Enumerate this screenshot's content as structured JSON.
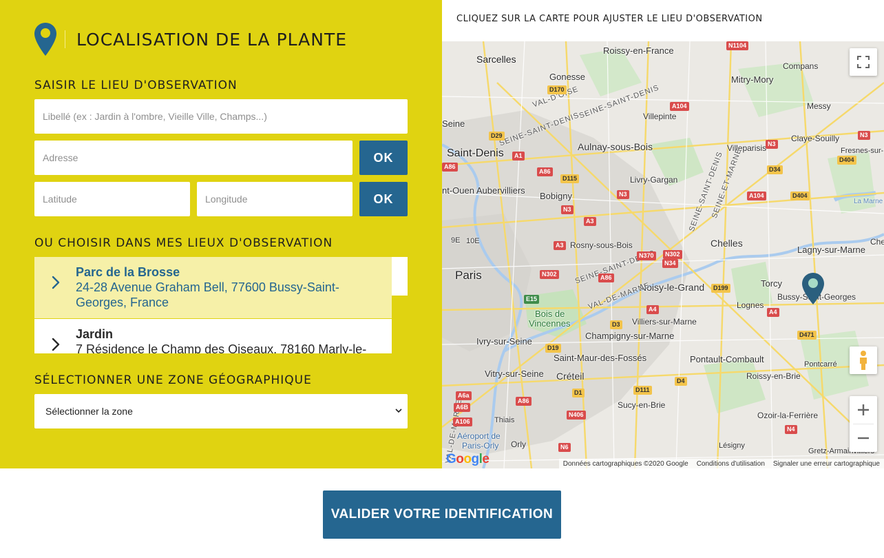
{
  "header": {
    "title": "LOCALISATION DE LA PLANTE"
  },
  "entry": {
    "section_label": "SAISIR LE LIEU D'OBSERVATION",
    "label_placeholder": "Libellé (ex : Jardin à l'ombre, Vieille Ville, Champs...)",
    "address_placeholder": "Adresse",
    "latitude_placeholder": "Latitude",
    "longitude_placeholder": "Longitude",
    "ok_label": "OK"
  },
  "saved": {
    "section_label": "OU CHOISIR DANS MES LIEUX D'OBSERVATION",
    "items": [
      {
        "name": "Parc de la Brosse",
        "address": "24-28 Avenue Graham Bell, 77600 Bussy-Saint-Georges, France",
        "selected": true
      },
      {
        "name": "Jardin",
        "address": "7 Résidence le Champ des Oiseaux, 78160 Marly-le-Roi",
        "selected": false
      }
    ]
  },
  "zone": {
    "section_label": "SÉLECTIONNER UNE ZONE GÉOGRAPHIQUE",
    "selected": "Sélectionner la zone"
  },
  "map": {
    "instruction": "CLIQUEZ SUR LA CARTE POUR AJUSTER LE LIEU D'OBSERVATION",
    "places": {
      "roissy": "Roissy-en-France",
      "sarcelles": "Sarcelles",
      "gonesse": "Gonesse",
      "mitry": "Mitry-Mory",
      "compans": "Compans",
      "messy": "Messy",
      "villepinte": "Villepinte",
      "seine": "Seine",
      "saintdenis": "Saint-Denis",
      "aulnay": "Aulnay-sous-Bois",
      "villeparisis": "Villeparisis",
      "claye": "Claye-Souilly",
      "fresnes": "Fresnes-sur-M",
      "aubervilliers": "nt-Ouen Aubervilliers",
      "livry": "Livry-Gargan",
      "bobigny": "Bobigny",
      "lamarne": "La Marne",
      "paris": "Paris",
      "neuf": "9E",
      "dix": "10E",
      "rosny": "Rosny-sous-Bois",
      "chelles": "Chelles",
      "lagny": "Lagny-sur-Marne",
      "noisy": "Noisy-le-Grand",
      "torcy": "Torcy",
      "bussy": "Bussy-Saint-Georges",
      "lognes": "Lognes",
      "bois": "Bois de",
      "vincennes": "Vincennes",
      "villiers": "Villiers-sur-Marne",
      "champigny": "Champigny-sur-Marne",
      "ivry": "Ivry-sur-Seine",
      "pontault": "Pontault-Combault",
      "pontcarre": "Pontcarré",
      "saintmaur": "Saint-Maur-des-Fossés",
      "vitry": "Vitry-sur-Seine",
      "creteil": "Créteil",
      "roissybrie": "Roissy-en-Brie",
      "sucy": "Sucy-en-Brie",
      "ozoir": "Ozoir-la-Ferrière",
      "thiais": "Thiais",
      "aeroport": "Aéroport de",
      "parisorly": "Paris-Orly",
      "orly": "Orly",
      "lesigny": "Lésigny",
      "gretz": "Gretz-Armainvilliers",
      "chelleshort": "Che"
    },
    "departments": {
      "valdoise": "VAL-D'OISE",
      "ssd1": "SEINE-SAINT-DENIS",
      "ssd2": "SEINE-SAINT-DENIS",
      "ssd3": "SEINE-SAINT-DENIS",
      "ssd4": "SEINE-SAINT-DENIS",
      "sem": "SEINE-ET-MARNE",
      "vdm1": "VAL-DE-MARNE",
      "vdm2": "VAL-DE-MARNE"
    },
    "roads": {
      "n1104": "N1104",
      "d170": "D170",
      "a104a": "A104",
      "d29": "D29",
      "a1": "A1",
      "a86a": "A86",
      "a86b": "A86",
      "d115": "D115",
      "n3a": "N3",
      "n3b": "N3",
      "n3c": "N3",
      "n3d": "N3",
      "a3a": "A3",
      "a3b": "A3",
      "d34": "D34",
      "d404a": "D404",
      "d404b": "D404",
      "a104b": "A104",
      "n370": "N370",
      "n302a": "N302",
      "n34": "N34",
      "n302b": "N302",
      "a86c": "A86",
      "d199": "D199",
      "a4a": "A4",
      "a4b": "A4",
      "e15": "E15",
      "d3": "D3",
      "d471": "D471",
      "d19": "D19",
      "d4": "D4",
      "d111": "D111",
      "d1": "D1",
      "a6a": "A6a",
      "a6b": "A6B",
      "a86d": "A86",
      "a106": "A106",
      "n406": "N406",
      "n6": "N6",
      "n4": "N4"
    },
    "google": "Google",
    "footer": {
      "data": "Données cartographiques ©2020 Google",
      "terms": "Conditions d'utilisation",
      "report": "Signaler une erreur cartographique"
    }
  },
  "validate_label": "VALIDER VOTRE IDENTIFICATION",
  "colors": {
    "panel": "#e0d311",
    "primary": "#256690",
    "selected_row": "#f6f0a8"
  }
}
